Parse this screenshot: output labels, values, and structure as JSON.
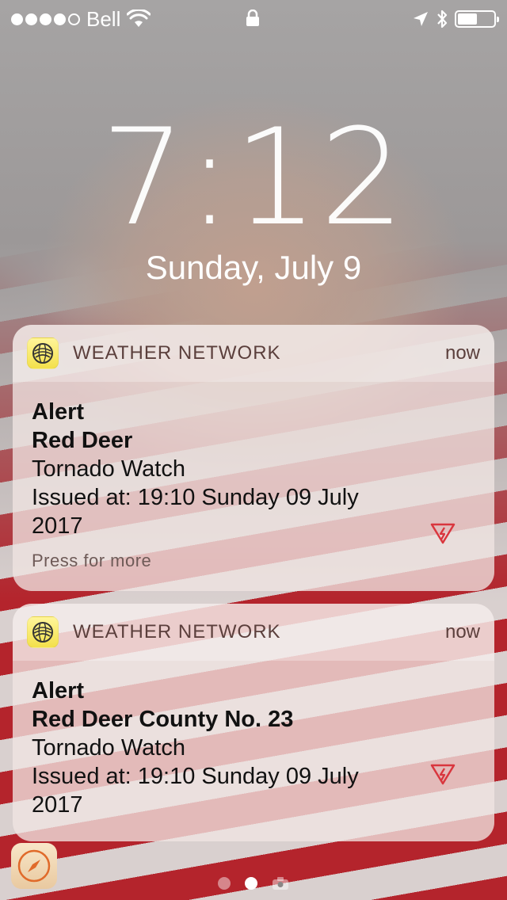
{
  "status_bar": {
    "carrier": "Bell",
    "signal_bars_filled": 4,
    "signal_bars_total": 5,
    "battery_level": 0.55,
    "icons": [
      "wifi-icon",
      "lock-icon",
      "location-arrow-icon",
      "bluetooth-icon",
      "battery-icon"
    ]
  },
  "lock_screen": {
    "time": "7:12",
    "date": "Sunday, July 9"
  },
  "notifications": [
    {
      "app_name": "WEATHER NETWORK",
      "time": "now",
      "title": "Alert",
      "location": "Red Deer",
      "message": "Tornado Watch",
      "issued": "Issued at: 19:10 Sunday 09 July 2017",
      "press_more": "Press for more",
      "icon": "weather-network-icon"
    },
    {
      "app_name": "WEATHER NETWORK",
      "time": "now",
      "title": "Alert",
      "location": "Red Deer County No. 23",
      "message": "Tornado Watch",
      "issued": "Issued at: 19:10 Sunday 09 July 2017",
      "icon": "weather-network-icon"
    }
  ],
  "bottom": {
    "app_shortcut_icon": "safari-compass-icon",
    "page_indicator": {
      "count": 3,
      "active_index": 1
    }
  },
  "colors": {
    "alert_red": "#d9363e",
    "app_icon_yellow": "#f3e04a",
    "header_text": "#5b3f3c"
  }
}
